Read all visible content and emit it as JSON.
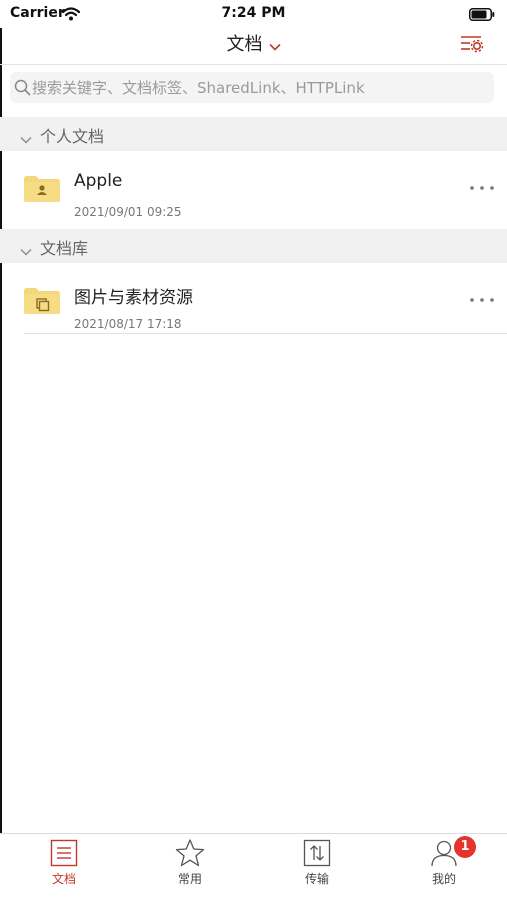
{
  "status_bar": {
    "carrier": "Carrier",
    "time": "7:24 PM"
  },
  "nav": {
    "title": "文档"
  },
  "search": {
    "placeholder": "搜索关键字、文档标签、SharedLink、HTTPLink"
  },
  "sections": [
    {
      "label": "个人文档",
      "items": [
        {
          "name": "Apple",
          "date": "2021/09/01 09:25",
          "icon": "personal-folder-icon"
        }
      ]
    },
    {
      "label": "文档库",
      "items": [
        {
          "name": "图片与素材资源",
          "date": "2021/08/17 17:18",
          "icon": "library-folder-icon"
        }
      ]
    }
  ],
  "tabs": [
    {
      "label": "文档",
      "icon": "document-list-icon",
      "active": true
    },
    {
      "label": "常用",
      "icon": "star-icon",
      "active": false
    },
    {
      "label": "传输",
      "icon": "transfer-icon",
      "active": false
    },
    {
      "label": "我的",
      "icon": "user-icon",
      "active": false,
      "badge": "1"
    }
  ],
  "colors": {
    "accent": "#c0392b",
    "folder": "#f5d77a",
    "badge": "#e5342c",
    "section_bg": "#f1f1f1"
  }
}
